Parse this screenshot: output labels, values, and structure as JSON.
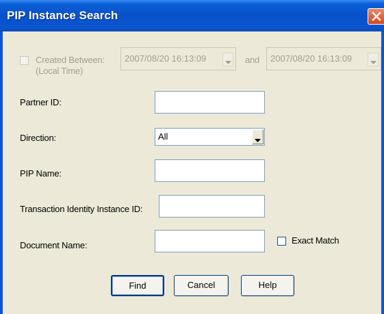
{
  "window": {
    "title": "PIP Instance Search",
    "close_icon": "close-icon"
  },
  "created_between": {
    "label": "Created Between:",
    "sublabel": "(Local Time)",
    "checked": false,
    "enabled": false,
    "from_value": "2007/08/20  16:13:09",
    "and_label": "and",
    "to_value": "2007/08/20  16:13:09"
  },
  "partner_id": {
    "label": "Partner ID:",
    "value": ""
  },
  "direction": {
    "label": "Direction:",
    "value": "All"
  },
  "pip_name": {
    "label": "PIP Name:",
    "value": ""
  },
  "transaction_id": {
    "label": "Transaction Identity Instance ID:",
    "value": ""
  },
  "document_name": {
    "label": "Document Name:",
    "value": ""
  },
  "exact_match": {
    "label": "Exact Match",
    "checked": false
  },
  "buttons": {
    "find": "Find",
    "cancel": "Cancel",
    "help": "Help"
  },
  "colors": {
    "titlebar": "#0751c9",
    "dialog_bg": "#ece9d8",
    "close_button": "#d1491f"
  }
}
